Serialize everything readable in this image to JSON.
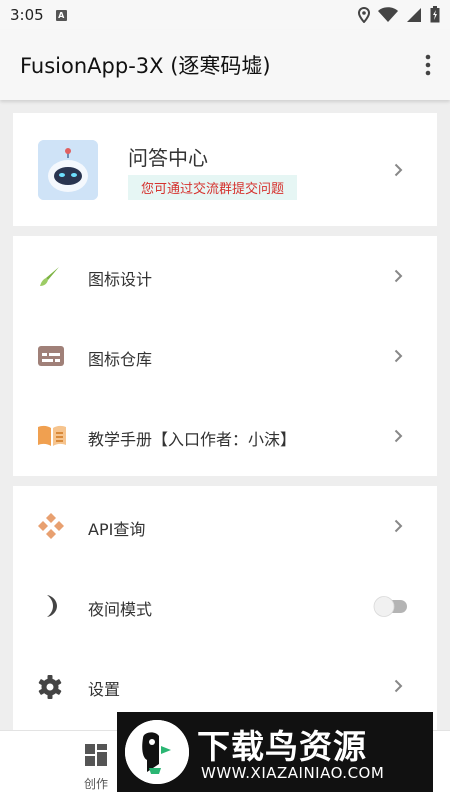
{
  "status_bar": {
    "time": "3:05",
    "notification_icon": "A"
  },
  "app_bar": {
    "title": "FusionApp-3X (逐寒码墟)",
    "menu_icon": "more-vert-icon"
  },
  "qa_card": {
    "title": "问答中心",
    "subtitle": "您可通过交流群提交问题"
  },
  "menu_group_1": {
    "items": [
      {
        "label": "图标设计",
        "icon": "brush-icon"
      },
      {
        "label": "图标仓库",
        "icon": "keyboard-icon"
      },
      {
        "label": "教学手册【入口作者：小沫】",
        "icon": "book-icon"
      }
    ]
  },
  "menu_group_2": {
    "items": [
      {
        "label": "API查询",
        "icon": "api-icon"
      },
      {
        "label": "夜间模式",
        "icon": "moon-icon",
        "toggle": false
      },
      {
        "label": "设置",
        "icon": "gear-icon"
      }
    ]
  },
  "bottom_nav": {
    "tab_create": "创作"
  },
  "watermark": {
    "name": "下载鸟资源",
    "url": "WWW.XIAZAINIAO.COM"
  },
  "colors": {
    "accent_red": "#d5322e",
    "brush": "#7cb342",
    "book": "#f0a050",
    "api": "#e8a070"
  }
}
